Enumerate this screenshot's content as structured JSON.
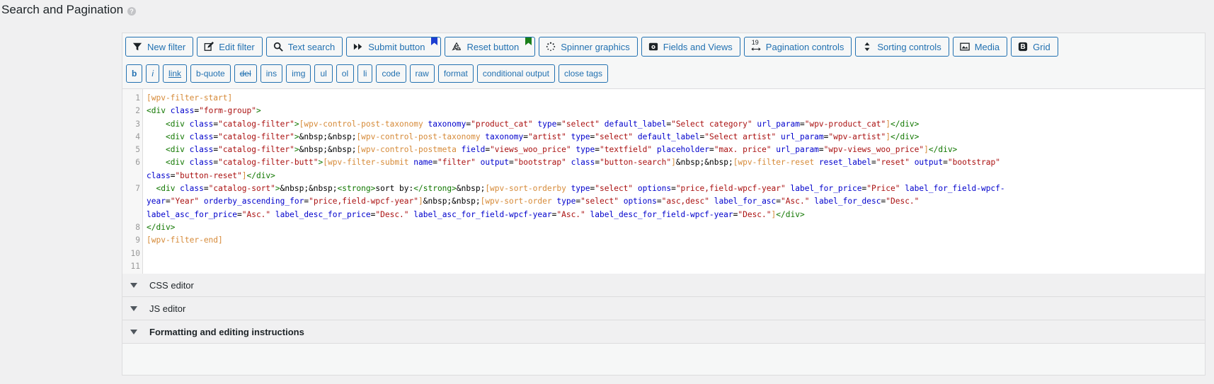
{
  "section": {
    "title": "Search and Pagination",
    "help": "?"
  },
  "toolbar": [
    {
      "name": "new-filter-button",
      "icon": "filter-icon",
      "label": "New filter"
    },
    {
      "name": "edit-filter-button",
      "icon": "edit-icon",
      "label": "Edit filter"
    },
    {
      "name": "text-search-button",
      "icon": "search-icon",
      "label": "Text search"
    },
    {
      "name": "submit-button-button",
      "icon": "forward-icon",
      "label": "Submit button",
      "bookmark": "#1d3fd1"
    },
    {
      "name": "reset-button-button",
      "icon": "recycle-icon",
      "label": "Reset button",
      "bookmark": "#1a7f1a"
    },
    {
      "name": "spinner-graphics-button",
      "icon": "spinner-icon",
      "label": "Spinner graphics"
    },
    {
      "name": "fields-and-views-button",
      "icon": "views-icon",
      "label": "Fields and Views"
    },
    {
      "name": "pagination-controls-button",
      "icon": "pagination-icon",
      "label": "Pagination controls",
      "icon_text": "19"
    },
    {
      "name": "sorting-controls-button",
      "icon": "sort-icon",
      "label": "Sorting controls"
    },
    {
      "name": "media-button",
      "icon": "image-icon",
      "label": "Media"
    },
    {
      "name": "grid-button",
      "icon": "bootstrap-icon",
      "label": "Grid",
      "icon_text": "B"
    }
  ],
  "quicktags": [
    {
      "label": "b",
      "style": "bold"
    },
    {
      "label": "i",
      "style": "italic"
    },
    {
      "label": "link",
      "style": "underline"
    },
    {
      "label": "b-quote",
      "style": ""
    },
    {
      "label": "del",
      "style": "strike"
    },
    {
      "label": "ins",
      "style": ""
    },
    {
      "label": "img",
      "style": ""
    },
    {
      "label": "ul",
      "style": ""
    },
    {
      "label": "ol",
      "style": ""
    },
    {
      "label": "li",
      "style": ""
    },
    {
      "label": "code",
      "style": ""
    },
    {
      "label": "raw",
      "style": ""
    },
    {
      "label": "format",
      "style": ""
    },
    {
      "label": "conditional output",
      "style": ""
    },
    {
      "label": "close tags",
      "style": ""
    }
  ],
  "code_lines": [
    {
      "n": "1",
      "segments": [
        [
          "sc",
          "[wpv-filter-start]"
        ]
      ]
    },
    {
      "n": "2",
      "segments": [
        [
          "tg",
          "<div "
        ],
        [
          "at",
          "class"
        ],
        [
          "tx",
          "="
        ],
        [
          "st",
          "\"form-group\""
        ],
        [
          "tg",
          ">"
        ]
      ]
    },
    {
      "n": "3",
      "segments": [
        [
          "tx",
          "    "
        ],
        [
          "tg",
          "<div "
        ],
        [
          "at",
          "class"
        ],
        [
          "tx",
          "="
        ],
        [
          "st",
          "\"catalog-filter\""
        ],
        [
          "tg",
          ">"
        ],
        [
          "sc",
          "[wpv-control-post-taxonomy "
        ],
        [
          "at",
          "taxonomy"
        ],
        [
          "tx",
          "="
        ],
        [
          "st",
          "\"product_cat\""
        ],
        [
          "tx",
          " "
        ],
        [
          "at",
          "type"
        ],
        [
          "tx",
          "="
        ],
        [
          "st",
          "\"select\""
        ],
        [
          "tx",
          " "
        ],
        [
          "at",
          "default_label"
        ],
        [
          "tx",
          "="
        ],
        [
          "st",
          "\"Select category\""
        ],
        [
          "tx",
          " "
        ],
        [
          "at",
          "url_param"
        ],
        [
          "tx",
          "="
        ],
        [
          "st",
          "\"wpv-product_cat\""
        ],
        [
          "sc",
          "]"
        ],
        [
          "tg",
          "</div>"
        ]
      ]
    },
    {
      "n": "4",
      "segments": [
        [
          "tx",
          "    "
        ],
        [
          "tg",
          "<div "
        ],
        [
          "at",
          "class"
        ],
        [
          "tx",
          "="
        ],
        [
          "st",
          "\"catalog-filter\""
        ],
        [
          "tg",
          ">"
        ],
        [
          "tx",
          "&nbsp;&nbsp;"
        ],
        [
          "sc",
          "[wpv-control-post-taxonomy "
        ],
        [
          "at",
          "taxonomy"
        ],
        [
          "tx",
          "="
        ],
        [
          "st",
          "\"artist\""
        ],
        [
          "tx",
          " "
        ],
        [
          "at",
          "type"
        ],
        [
          "tx",
          "="
        ],
        [
          "st",
          "\"select\""
        ],
        [
          "tx",
          " "
        ],
        [
          "at",
          "default_label"
        ],
        [
          "tx",
          "="
        ],
        [
          "st",
          "\"Select artist\""
        ],
        [
          "tx",
          " "
        ],
        [
          "at",
          "url_param"
        ],
        [
          "tx",
          "="
        ],
        [
          "st",
          "\"wpv-artist\""
        ],
        [
          "sc",
          "]"
        ],
        [
          "tg",
          "</div>"
        ]
      ]
    },
    {
      "n": "5",
      "segments": [
        [
          "tx",
          "    "
        ],
        [
          "tg",
          "<div "
        ],
        [
          "at",
          "class"
        ],
        [
          "tx",
          "="
        ],
        [
          "st",
          "\"catalog-filter\""
        ],
        [
          "tg",
          ">"
        ],
        [
          "tx",
          "&nbsp;&nbsp;"
        ],
        [
          "sc",
          "[wpv-control-postmeta "
        ],
        [
          "at",
          "field"
        ],
        [
          "tx",
          "="
        ],
        [
          "st",
          "\"views_woo_price\""
        ],
        [
          "tx",
          " "
        ],
        [
          "at",
          "type"
        ],
        [
          "tx",
          "="
        ],
        [
          "st",
          "\"textfield\""
        ],
        [
          "tx",
          " "
        ],
        [
          "at",
          "placeholder"
        ],
        [
          "tx",
          "="
        ],
        [
          "st",
          "\"max. price\""
        ],
        [
          "tx",
          " "
        ],
        [
          "at",
          "url_param"
        ],
        [
          "tx",
          "="
        ],
        [
          "st",
          "\"wpv-views_woo_price\""
        ],
        [
          "sc",
          "]"
        ],
        [
          "tg",
          "</div>"
        ]
      ]
    },
    {
      "n": "6",
      "segments": [
        [
          "tx",
          "    "
        ],
        [
          "tg",
          "<div "
        ],
        [
          "at",
          "class"
        ],
        [
          "tx",
          "="
        ],
        [
          "st",
          "\"catalog-filter-butt\""
        ],
        [
          "tg",
          ">"
        ],
        [
          "sc",
          "[wpv-filter-submit "
        ],
        [
          "at",
          "name"
        ],
        [
          "tx",
          "="
        ],
        [
          "st",
          "\"filter\""
        ],
        [
          "tx",
          " "
        ],
        [
          "at",
          "output"
        ],
        [
          "tx",
          "="
        ],
        [
          "st",
          "\"bootstrap\""
        ],
        [
          "tx",
          " "
        ],
        [
          "at",
          "class"
        ],
        [
          "tx",
          "="
        ],
        [
          "st",
          "\"button-search\""
        ],
        [
          "sc",
          "]"
        ],
        [
          "tx",
          "&nbsp;&nbsp;"
        ],
        [
          "sc",
          "[wpv-filter-reset "
        ],
        [
          "at",
          "reset_label"
        ],
        [
          "tx",
          "="
        ],
        [
          "st",
          "\"reset\""
        ],
        [
          "tx",
          " "
        ],
        [
          "at",
          "output"
        ],
        [
          "tx",
          "="
        ],
        [
          "st",
          "\"bootstrap\""
        ]
      ]
    },
    {
      "n": "",
      "segments": [
        [
          "at",
          "class"
        ],
        [
          "tx",
          "="
        ],
        [
          "st",
          "\"button-reset\""
        ],
        [
          "sc",
          "]"
        ],
        [
          "tg",
          "</div>"
        ]
      ]
    },
    {
      "n": "7",
      "segments": [
        [
          "tx",
          "  "
        ],
        [
          "tg",
          "<div "
        ],
        [
          "at",
          "class"
        ],
        [
          "tx",
          "="
        ],
        [
          "st",
          "\"catalog-sort\""
        ],
        [
          "tg",
          ">"
        ],
        [
          "tx",
          "&nbsp;&nbsp;"
        ],
        [
          "tg",
          "<strong>"
        ],
        [
          "tx",
          "sort by:"
        ],
        [
          "tg",
          "</strong>"
        ],
        [
          "tx",
          "&nbsp;"
        ],
        [
          "sc",
          "[wpv-sort-orderby "
        ],
        [
          "at",
          "type"
        ],
        [
          "tx",
          "="
        ],
        [
          "st",
          "\"select\""
        ],
        [
          "tx",
          " "
        ],
        [
          "at",
          "options"
        ],
        [
          "tx",
          "="
        ],
        [
          "st",
          "\"price,field-wpcf-year\""
        ],
        [
          "tx",
          " "
        ],
        [
          "at",
          "label_for_price"
        ],
        [
          "tx",
          "="
        ],
        [
          "st",
          "\"Price\""
        ],
        [
          "tx",
          " "
        ],
        [
          "at",
          "label_for_field-wpcf-"
        ]
      ]
    },
    {
      "n": "",
      "segments": [
        [
          "at",
          "year"
        ],
        [
          "tx",
          "="
        ],
        [
          "st",
          "\"Year\""
        ],
        [
          "tx",
          " "
        ],
        [
          "at",
          "orderby_ascending_for"
        ],
        [
          "tx",
          "="
        ],
        [
          "st",
          "\"price,field-wpcf-year\""
        ],
        [
          "sc",
          "]"
        ],
        [
          "tx",
          "&nbsp;&nbsp;"
        ],
        [
          "sc",
          "[wpv-sort-order "
        ],
        [
          "at",
          "type"
        ],
        [
          "tx",
          "="
        ],
        [
          "st",
          "\"select\""
        ],
        [
          "tx",
          " "
        ],
        [
          "at",
          "options"
        ],
        [
          "tx",
          "="
        ],
        [
          "st",
          "\"asc,desc\""
        ],
        [
          "tx",
          " "
        ],
        [
          "at",
          "label_for_asc"
        ],
        [
          "tx",
          "="
        ],
        [
          "st",
          "\"Asc.\""
        ],
        [
          "tx",
          " "
        ],
        [
          "at",
          "label_for_desc"
        ],
        [
          "tx",
          "="
        ],
        [
          "st",
          "\"Desc.\""
        ]
      ]
    },
    {
      "n": "",
      "segments": [
        [
          "at",
          "label_asc_for_price"
        ],
        [
          "tx",
          "="
        ],
        [
          "st",
          "\"Asc.\""
        ],
        [
          "tx",
          " "
        ],
        [
          "at",
          "label_desc_for_price"
        ],
        [
          "tx",
          "="
        ],
        [
          "st",
          "\"Desc.\""
        ],
        [
          "tx",
          " "
        ],
        [
          "at",
          "label_asc_for_field-wpcf-year"
        ],
        [
          "tx",
          "="
        ],
        [
          "st",
          "\"Asc.\""
        ],
        [
          "tx",
          " "
        ],
        [
          "at",
          "label_desc_for_field-wpcf-year"
        ],
        [
          "tx",
          "="
        ],
        [
          "st",
          "\"Desc.\""
        ],
        [
          "sc",
          "]"
        ],
        [
          "tg",
          "</div>"
        ]
      ]
    },
    {
      "n": "8",
      "segments": [
        [
          "tg",
          "</div>"
        ]
      ]
    },
    {
      "n": "9",
      "segments": [
        [
          "sc",
          "[wpv-filter-end]"
        ]
      ]
    },
    {
      "n": "10",
      "segments": []
    },
    {
      "n": "11",
      "segments": []
    }
  ],
  "accordions": [
    {
      "name": "css-editor-toggle",
      "label": "CSS editor",
      "bold": false
    },
    {
      "name": "js-editor-toggle",
      "label": "JS editor",
      "bold": false
    },
    {
      "name": "formatting-instructions-toggle",
      "label": "Formatting and editing instructions",
      "bold": true
    }
  ]
}
